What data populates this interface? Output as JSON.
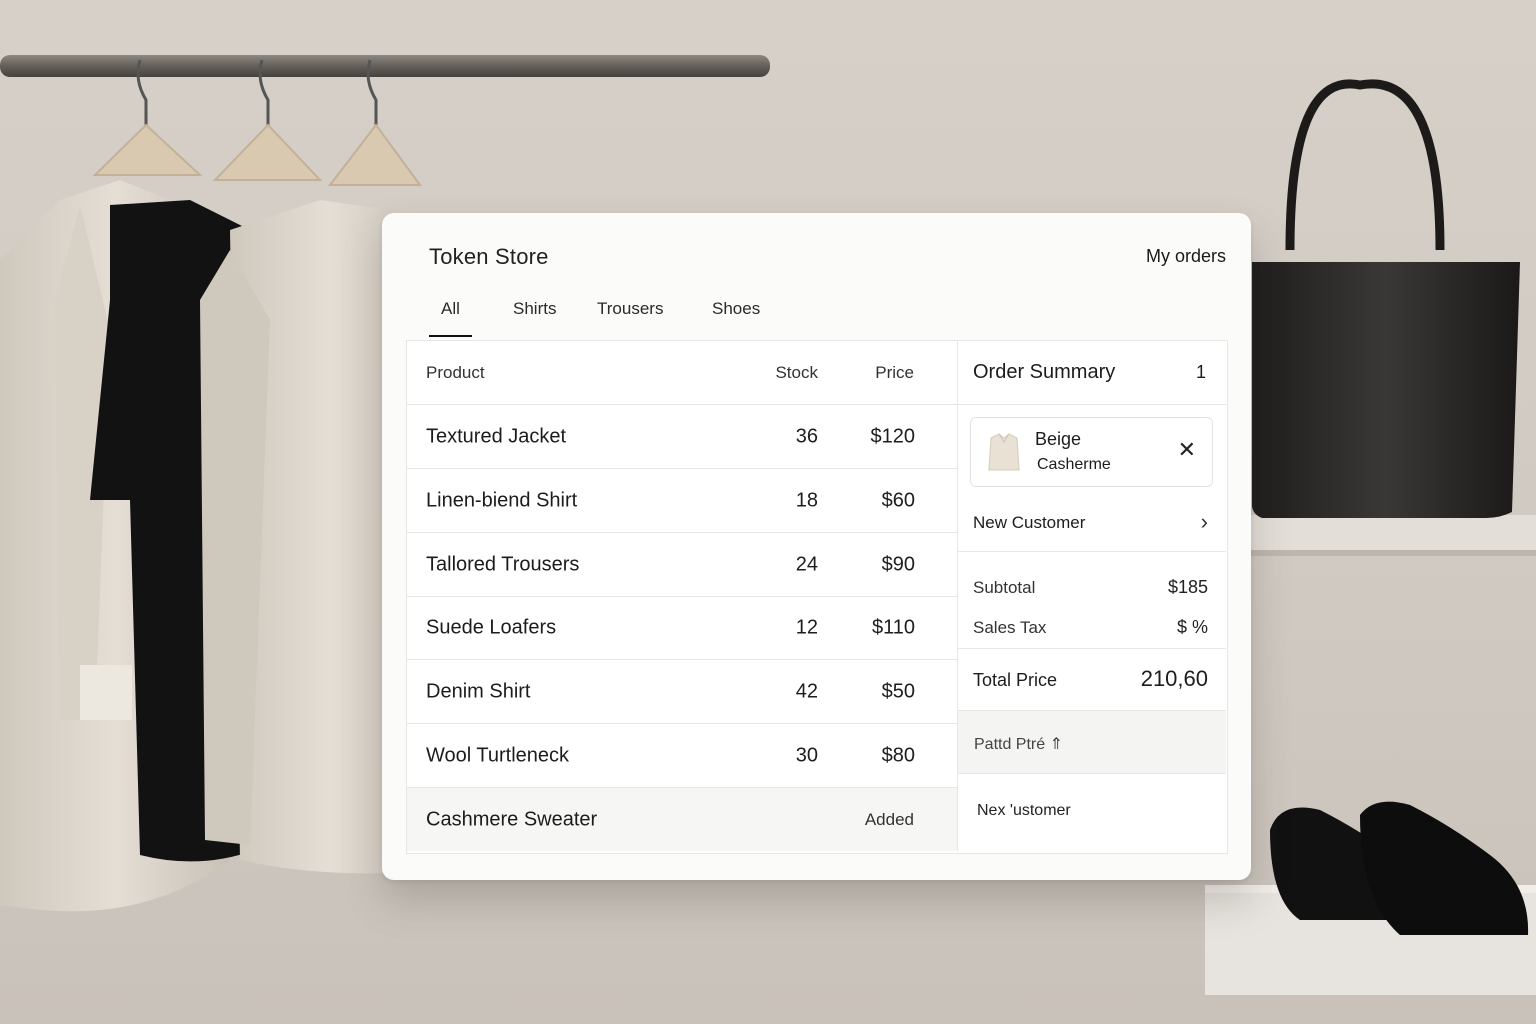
{
  "header": {
    "brand": "Token Store",
    "orders_link": "My orders"
  },
  "tabs": [
    {
      "label": "All",
      "active": true
    },
    {
      "label": "Shirts",
      "active": false
    },
    {
      "label": "Trousers",
      "active": false
    },
    {
      "label": "Shoes",
      "active": false
    }
  ],
  "table": {
    "columns": [
      "Product",
      "Stock",
      "Price"
    ],
    "rows": [
      {
        "product": "Textured Jacket",
        "stock": "36",
        "price": "$120"
      },
      {
        "product": "Linen-biend Shirt",
        "stock": "18",
        "price": "$60"
      },
      {
        "product": "Tallored Trousers",
        "stock": "24",
        "price": "$90"
      },
      {
        "product": "Suede Loafers",
        "stock": "12",
        "price": "$110"
      },
      {
        "product": "Denim Shirt",
        "stock": "42",
        "price": "$50"
      },
      {
        "product": "Wool Turtleneck",
        "stock": "30",
        "price": "$80"
      }
    ],
    "added_row": {
      "product": "Cashmere Sweater",
      "status": "Added"
    }
  },
  "summary": {
    "title": "Order Summary",
    "count": "1",
    "item": {
      "line1": "Beige",
      "line2": "Casherme",
      "remove_icon": "close-icon"
    },
    "customer": {
      "label": "New Customer",
      "icon": "chevron-right-icon"
    },
    "subtotal": {
      "label": "Subtotal",
      "value": "$185"
    },
    "tax": {
      "label": "Sales Tax",
      "value": "$ %"
    },
    "total": {
      "label": "Total Price",
      "value": "210,60"
    },
    "paid_label": "Pattd Ptré ⇑",
    "next_label": "Nex 'ustomer"
  },
  "colors": {
    "panel": "#fbfbfa",
    "wall": "#d3cdc6",
    "accent": "#111111"
  }
}
